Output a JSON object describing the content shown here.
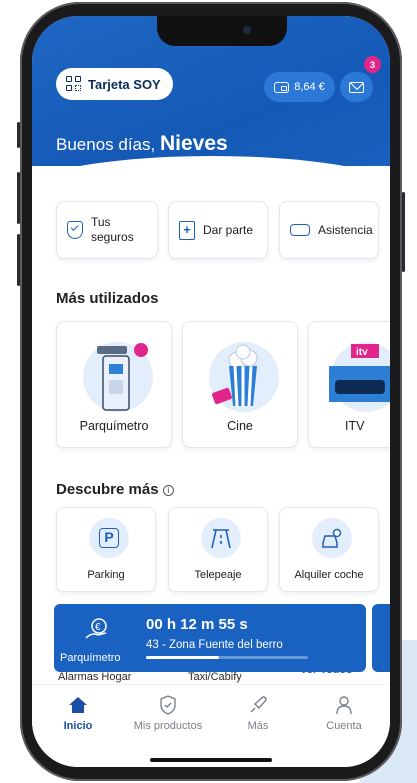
{
  "header": {
    "card_button_label": "Tarjeta SOY",
    "wallet_balance": "8,64 €",
    "notifications_count": "3",
    "greeting": "Buenos días,",
    "user_name": "Nieves"
  },
  "quick_actions": [
    {
      "label_line1": "Tus",
      "label_line2": "seguros",
      "icon": "shield-check-icon"
    },
    {
      "label": "Dar parte",
      "icon": "document-plus-icon"
    },
    {
      "label": "Asistencia",
      "icon": "tow-truck-icon"
    }
  ],
  "most_used": {
    "title": "Más utilizados",
    "items": [
      {
        "label": "Parquímetro",
        "icon": "parking-meter-icon"
      },
      {
        "label": "Cine",
        "icon": "popcorn-icon"
      },
      {
        "label": "ITV",
        "icon": "itv-station-icon",
        "badge": "itv"
      }
    ]
  },
  "discover": {
    "title": "Descubre más",
    "items": [
      {
        "label": "Parking",
        "icon": "parking-p-icon"
      },
      {
        "label": "Telepeaje",
        "icon": "highway-toll-icon"
      },
      {
        "label": "Alquiler coche",
        "icon": "car-key-icon"
      }
    ]
  },
  "active_parking": {
    "label": "Parquímetro",
    "time": "00 h 12 m 55 s",
    "zone": "43 - Zona Fuente del berro",
    "progress": 0.45
  },
  "peek_row": [
    "Alarmas Hogar",
    "Taxi/Cabify",
    "Ver Todos"
  ],
  "tabs": [
    {
      "label": "Inicio",
      "icon": "home-icon",
      "active": true
    },
    {
      "label": "Mis productos",
      "icon": "shield-icon",
      "active": false
    },
    {
      "label": "Más",
      "icon": "rocket-icon",
      "active": false
    },
    {
      "label": "Cuenta",
      "icon": "user-icon",
      "active": false
    }
  ],
  "colors": {
    "brand_blue": "#1a62c2",
    "accent_pink": "#e0268a",
    "text_dark": "#1d1d1d"
  }
}
